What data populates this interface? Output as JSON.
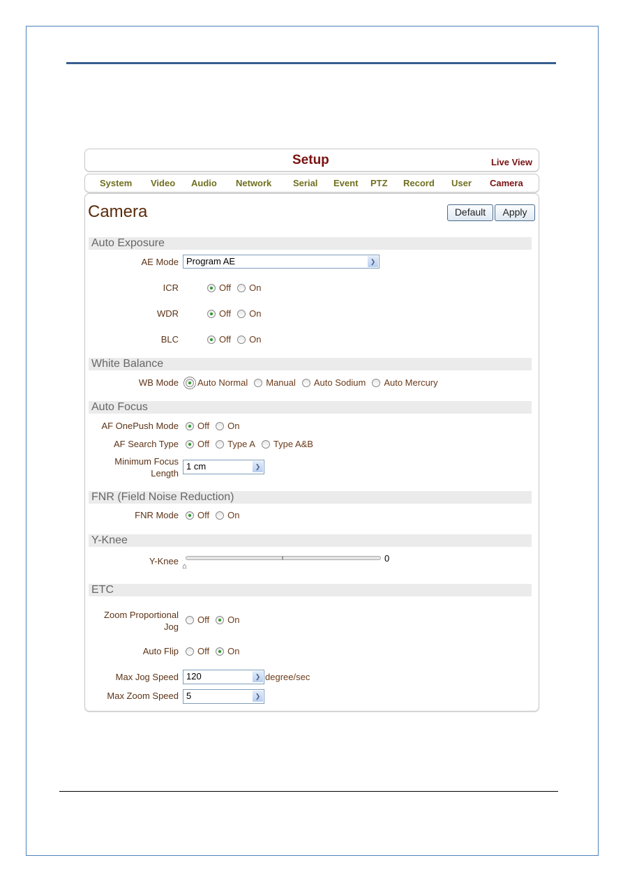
{
  "header": {
    "title": "Setup",
    "live_view": "Live View"
  },
  "nav": [
    "System",
    "Video",
    "Audio",
    "Network",
    "Serial",
    "Event",
    "PTZ",
    "Record",
    "User",
    "Camera"
  ],
  "nav_active": "Camera",
  "page": {
    "title": "Camera",
    "default_label": "Default",
    "apply_label": "Apply"
  },
  "auto_exposure": {
    "header": "Auto Exposure",
    "ae_mode_label": "AE Mode",
    "ae_mode_value": "Program AE",
    "icr_label": "ICR",
    "wdr_label": "WDR",
    "blc_label": "BLC",
    "off": "Off",
    "on": "On",
    "icr": "Off",
    "wdr": "Off",
    "blc": "Off"
  },
  "white_balance": {
    "header": "White Balance",
    "wb_mode_label": "WB Mode",
    "options": [
      "Auto Normal",
      "Manual",
      "Auto Sodium",
      "Auto Mercury"
    ],
    "selected": "Auto Normal"
  },
  "auto_focus": {
    "header": "Auto Focus",
    "onepush_label": "AF OnePush Mode",
    "onepush": "Off",
    "search_label": "AF Search Type",
    "search_options": [
      "Off",
      "Type A",
      "Type A&B"
    ],
    "search": "Off",
    "min_focus_label_1": "Minimum Focus",
    "min_focus_label_2": "Length",
    "min_focus_value": "1 cm"
  },
  "fnr": {
    "header": "FNR (Field Noise Reduction)",
    "mode_label": "FNR Mode",
    "mode": "Off"
  },
  "yknee": {
    "header": "Y-Knee",
    "label": "Y-Knee",
    "value": "0"
  },
  "etc": {
    "header": "ETC",
    "zoom_prop_label_1": "Zoom Proportional",
    "zoom_prop_label_2": "Jog",
    "zoom_prop": "On",
    "auto_flip_label": "Auto Flip",
    "auto_flip": "On",
    "max_jog_label": "Max Jog Speed",
    "max_jog_value": "120",
    "max_jog_unit": "degree/sec",
    "max_zoom_label": "Max Zoom Speed",
    "max_zoom_value": "5"
  },
  "colors": {
    "accent": "#7a1212",
    "nav": "#6f6f1f",
    "radio_selected": "#2a9a2a"
  }
}
